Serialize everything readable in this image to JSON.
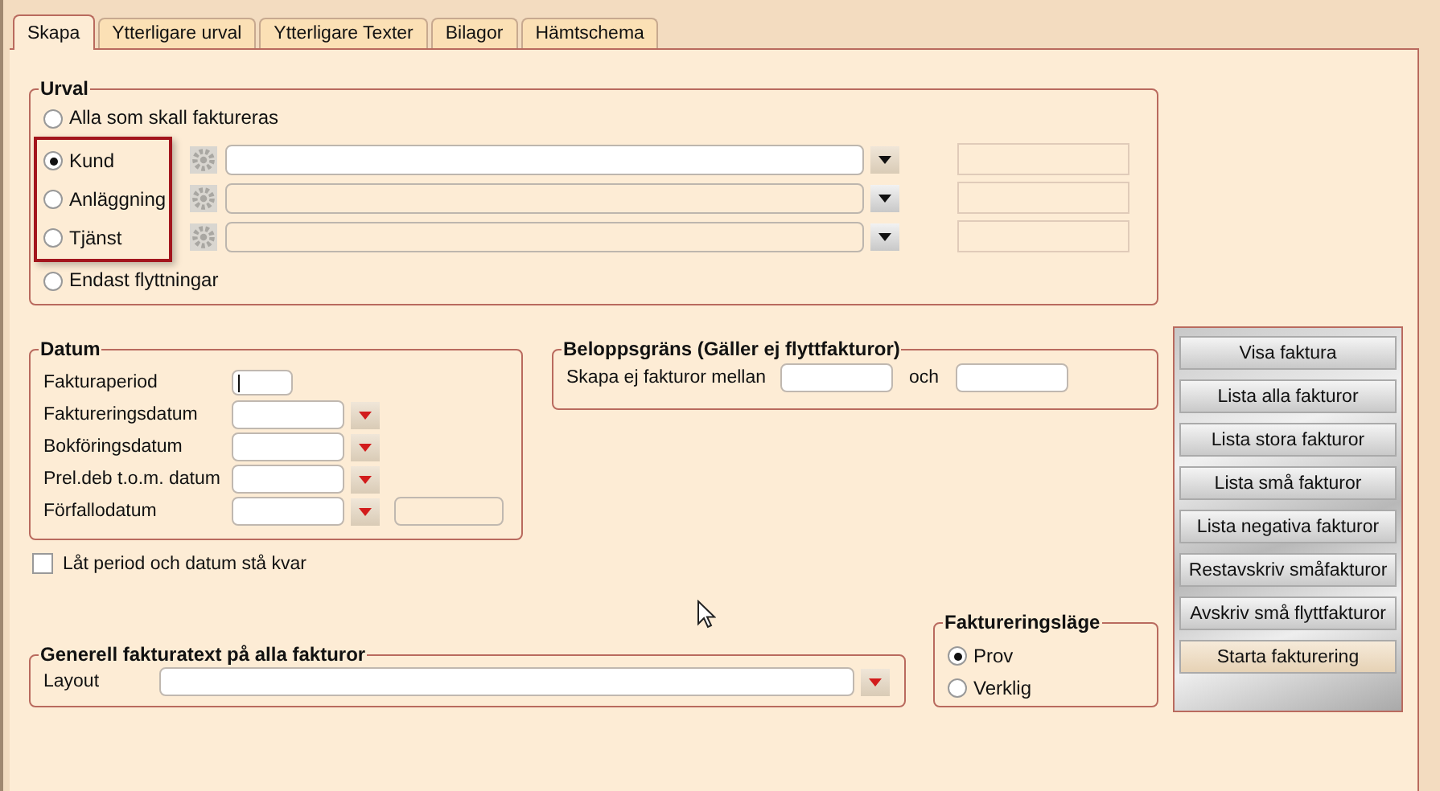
{
  "tabs": [
    {
      "label": "Skapa",
      "selected": true
    },
    {
      "label": "Ytterligare urval",
      "selected": false
    },
    {
      "label": "Ytterligare Texter",
      "selected": false
    },
    {
      "label": "Bilagor",
      "selected": false
    },
    {
      "label": "Hämtschema",
      "selected": false
    }
  ],
  "urval": {
    "title": "Urval",
    "options": [
      {
        "label": "Alla som skall faktureras",
        "selected": false,
        "kind": "plain"
      },
      {
        "label": "Kund",
        "selected": true,
        "kind": "lookup",
        "enabled": true
      },
      {
        "label": "Anläggning",
        "selected": false,
        "kind": "lookup",
        "enabled": false
      },
      {
        "label": "Tjänst",
        "selected": false,
        "kind": "lookup",
        "enabled": false
      },
      {
        "label": "Endast flyttningar",
        "selected": false,
        "kind": "plain"
      }
    ]
  },
  "datum": {
    "title": "Datum",
    "fields": [
      {
        "label": "Fakturaperiod",
        "kind": "period"
      },
      {
        "label": "Faktureringsdatum",
        "kind": "date"
      },
      {
        "label": "Bokföringsdatum",
        "kind": "date"
      },
      {
        "label": "Prel.deb t.o.m. datum",
        "kind": "date"
      },
      {
        "label": "Förfallodatum",
        "kind": "date_extra"
      }
    ]
  },
  "keep_checkbox": {
    "label": "Låt period och datum stå kvar",
    "checked": false
  },
  "belopp": {
    "title": "Beloppsgräns (Gäller ej flyttfakturor)",
    "label": "Skapa ej fakturor mellan",
    "between": "och"
  },
  "layout_group": {
    "title": "Generell fakturatext på alla fakturor",
    "label": "Layout"
  },
  "mode": {
    "title": "Faktureringsläge",
    "options": [
      {
        "label": "Prov",
        "selected": true
      },
      {
        "label": "Verklig",
        "selected": false
      }
    ]
  },
  "buttons": [
    {
      "label": "Visa faktura",
      "primary": false
    },
    {
      "label": "Lista alla fakturor",
      "primary": false
    },
    {
      "label": "Lista stora fakturor",
      "primary": false
    },
    {
      "label": "Lista små fakturor",
      "primary": false
    },
    {
      "label": "Lista negativa fakturor",
      "primary": false
    },
    {
      "label": "Restavskriv småfakturor",
      "primary": false
    },
    {
      "label": "Avskriv små flyttfakturor",
      "primary": false
    },
    {
      "label": "Starta fakturering",
      "primary": true
    }
  ]
}
